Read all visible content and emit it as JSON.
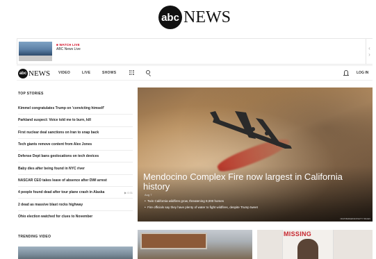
{
  "brand": {
    "logo_mark": "abc",
    "logo_word": "NEWS"
  },
  "live_banner": {
    "label": "WATCH LIVE",
    "title": "ABC News Live"
  },
  "nav": {
    "items": [
      "VIDEO",
      "LIVE",
      "SHOWS"
    ],
    "login": "LOG IN",
    "icons": [
      "grid-icon",
      "search-icon",
      "bell-icon"
    ]
  },
  "top_stories": {
    "title": "TOP STORIES",
    "items": [
      {
        "text": "Kimmel congratulates Trump on 'convicting himself'",
        "video": ""
      },
      {
        "text": "Parkland suspect: Voice told me to burn, kill",
        "video": ""
      },
      {
        "text": "First nuclear deal sanctions on Iran to snap back",
        "video": ""
      },
      {
        "text": "Tech giants remove content from Alex Jones",
        "video": ""
      },
      {
        "text": "Defense Dept bans geolocations on tech devices",
        "video": ""
      },
      {
        "text": "Baby dies after being found in NYC river",
        "video": ""
      },
      {
        "text": "NASCAR CEO takes leave of absence after DWI arrest",
        "video": ""
      },
      {
        "text": "4 people found dead after tour plane crash in Alaska",
        "video": "▶ 0:31"
      },
      {
        "text": "2 dead as massive blast rocks highway",
        "video": ""
      },
      {
        "text": "Ohio election watched for clues to November",
        "video": ""
      }
    ]
  },
  "trending": {
    "title": "TRENDING VIDEO"
  },
  "hero": {
    "headline": "Mendocino Complex Fire now largest in California history",
    "date": "Aug 7",
    "bullets": [
      "Twin California wildfires grow, threatening 9,000 homes",
      "Fire officials say they have plenty of water to fight wildfires, despite Trump tweet"
    ],
    "credit": "NOAH BERGER/AFP/GETTY IMAGES"
  },
  "cards": {
    "card2_text": "MISSING"
  }
}
